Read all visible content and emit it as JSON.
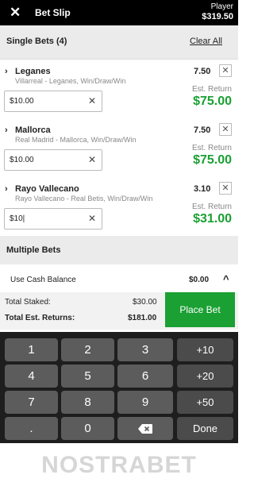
{
  "header": {
    "close_icon": "close-icon",
    "title": "Bet Slip",
    "account_label": "Player",
    "balance": "$319.50"
  },
  "singles": {
    "label": "Single Bets (4)",
    "clear_all": "Clear All",
    "bets": [
      {
        "selection": "Leganes",
        "market": "Villarreal - Leganes, Win/Draw/Win",
        "odds": "7.50",
        "stake": "$10.00",
        "est_return_label": "Est. Return",
        "est_return": "$75.00"
      },
      {
        "selection": "Mallorca",
        "market": "Real Madrid - Mallorca, Win/Draw/Win",
        "odds": "7.50",
        "stake": "$10.00",
        "est_return_label": "Est. Return",
        "est_return": "$75.00"
      },
      {
        "selection": "Rayo Vallecano",
        "market": "Rayo Vallecano - Real Betis, Win/Draw/Win",
        "odds": "3.10",
        "stake": "$10|",
        "est_return_label": "Est. Return",
        "est_return": "$31.00"
      }
    ]
  },
  "multiples": {
    "label": "Multiple Bets"
  },
  "cash_balance": {
    "label": "Use Cash Balance",
    "value": "$0.00"
  },
  "totals": {
    "staked_label": "Total Staked:",
    "staked": "$30.00",
    "returns_label": "Total Est. Returns:",
    "returns": "$181.00"
  },
  "place_bet": "Place Bet",
  "keypad": {
    "digits": [
      "1",
      "2",
      "3",
      "4",
      "5",
      "6",
      "7",
      "8",
      "9",
      ".",
      "0"
    ],
    "quick": [
      "+10",
      "+20",
      "+50"
    ],
    "backspace_icon": "backspace-icon",
    "done": "Done"
  },
  "watermark": "NOSTRABET",
  "colors": {
    "accent_green": "#1aa033",
    "header_bg": "#000000",
    "keypad_bg": "#1e1e1e"
  }
}
